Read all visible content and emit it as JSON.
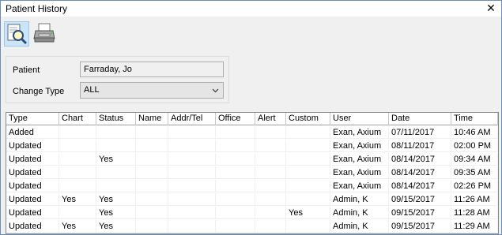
{
  "window": {
    "title": "Patient History",
    "close_glyph": "✕"
  },
  "toolbar": {
    "buttons": [
      {
        "name": "print-preview",
        "icon": "print-preview-icon"
      },
      {
        "name": "print",
        "icon": "printer-icon"
      }
    ]
  },
  "filter": {
    "patient_label": "Patient",
    "patient_value": "Farraday, Jo",
    "change_type_label": "Change Type",
    "change_type_value": "ALL"
  },
  "table": {
    "columns": [
      "Type",
      "Chart",
      "Status",
      "Name",
      "Addr/Tel",
      "Office",
      "Alert",
      "Custom",
      "User",
      "Date",
      "Time"
    ],
    "rows": [
      [
        "Added",
        "",
        "",
        "",
        "",
        "",
        "",
        "",
        "Exan, Axium",
        "07/11/2017",
        "10:46 AM"
      ],
      [
        "Updated",
        "",
        "",
        "",
        "",
        "",
        "",
        "",
        "Exan, Axium",
        "08/11/2017",
        "02:00 PM"
      ],
      [
        "Updated",
        "",
        "Yes",
        "",
        "",
        "",
        "",
        "",
        "Exan, Axium",
        "08/14/2017",
        "09:34 AM"
      ],
      [
        "Updated",
        "",
        "",
        "",
        "",
        "",
        "",
        "",
        "Exan, Axium",
        "08/14/2017",
        "09:35 AM"
      ],
      [
        "Updated",
        "",
        "",
        "",
        "",
        "",
        "",
        "",
        "Exan, Axium",
        "08/14/2017",
        "02:26 PM"
      ],
      [
        "Updated",
        "Yes",
        "Yes",
        "",
        "",
        "",
        "",
        "",
        "Admin, K",
        "09/15/2017",
        "11:26 AM"
      ],
      [
        "Updated",
        "",
        "Yes",
        "",
        "",
        "",
        "",
        "Yes",
        "Admin, K",
        "09/15/2017",
        "11:28 AM"
      ],
      [
        "Updated",
        "Yes",
        "Yes",
        "",
        "",
        "",
        "",
        "",
        "Admin, K",
        "09/15/2017",
        "11:29 AM"
      ]
    ]
  }
}
